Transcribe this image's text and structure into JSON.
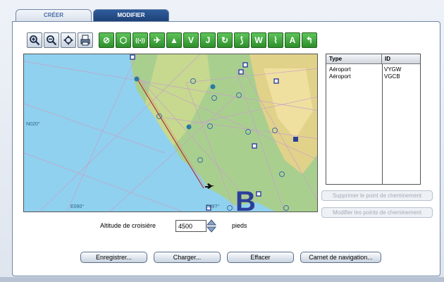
{
  "tabs": [
    {
      "label": "CRÉER",
      "active": false
    },
    {
      "label": "MODIFIER",
      "active": true
    }
  ],
  "toolbar": {
    "gray_icons": [
      "zoom-in-icon",
      "zoom-out-icon",
      "pan-move-icon",
      "print-icon"
    ],
    "green_labels": [
      "⊘",
      "⬡",
      "((•))",
      "✈",
      "▲",
      "V",
      "J",
      "↻",
      "⟆",
      "W",
      "⌇",
      "A",
      "↰"
    ]
  },
  "map": {
    "coordinates": [
      "N020°",
      "E090°",
      "E09?°"
    ],
    "big_letter": "B",
    "colors": {
      "sea": "#8fd1ee",
      "land": "#9fc98a",
      "route": "#b0302a",
      "airway": "#c8a0c8"
    }
  },
  "table": {
    "headers": {
      "type": "Type",
      "id": "ID"
    },
    "rows": [
      {
        "type": "Aéroport",
        "id": "VYGW"
      },
      {
        "type": "Aéroport",
        "id": "VGCB"
      }
    ]
  },
  "side_buttons": {
    "delete_waypoint": "Supprimer le point de cheminement",
    "modify_waypoints": "Modifier les points de cheminement"
  },
  "altitude": {
    "label": "Altitude de croisière",
    "value": "4500",
    "units": "pieds"
  },
  "buttons": {
    "save": "Enregistrer...",
    "load": "Charger...",
    "clear": "Effacer",
    "navlog": "Carnet de navigation..."
  }
}
